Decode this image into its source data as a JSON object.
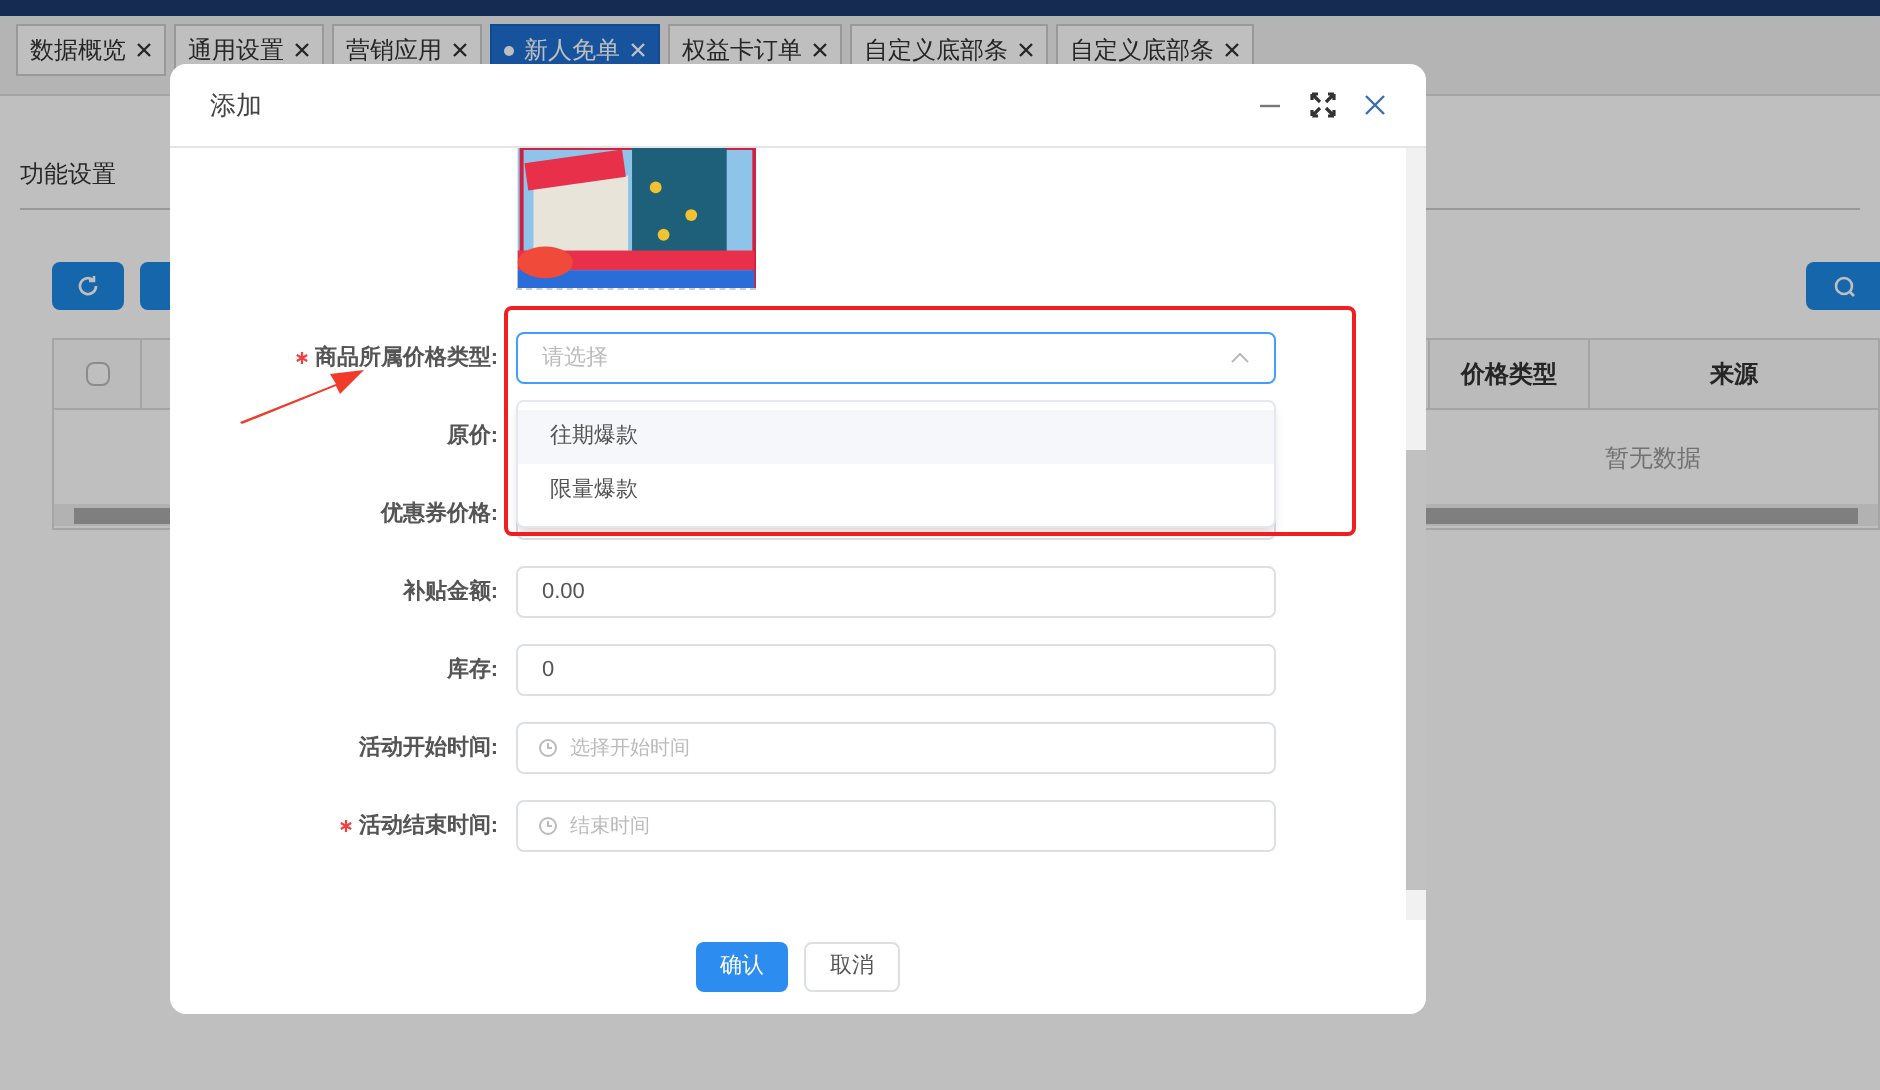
{
  "tabs": [
    {
      "label": "数据概览",
      "selected": false
    },
    {
      "label": "通用设置",
      "selected": false
    },
    {
      "label": "营销应用",
      "selected": false
    },
    {
      "label": "新人免单",
      "selected": true
    },
    {
      "label": "权益卡订单",
      "selected": false
    },
    {
      "label": "自定义底部条",
      "selected": false
    },
    {
      "label": "自定义底部条",
      "selected": false
    }
  ],
  "page": {
    "section_tab": "功能设置",
    "table": {
      "select_all_checked": false,
      "columns": [
        "价格类型",
        "来源"
      ],
      "empty_text": "暂无数据"
    }
  },
  "dialog": {
    "title": "添加",
    "form": [
      {
        "label": "商品所属价格类型:",
        "required": true,
        "kind": "select",
        "placeholder": "请选择",
        "expanded": true,
        "options": [
          {
            "label": "往期爆款",
            "hovered": true
          },
          {
            "label": "限量爆款",
            "hovered": false
          }
        ]
      },
      {
        "label": "原价:",
        "required": false,
        "kind": "input"
      },
      {
        "label": "优惠券价格:",
        "required": false,
        "kind": "input"
      },
      {
        "label": "补贴金额:",
        "required": false,
        "kind": "input",
        "value": "0.00"
      },
      {
        "label": "库存:",
        "required": false,
        "kind": "input",
        "value": "0"
      },
      {
        "label": "活动开始时间:",
        "required": false,
        "kind": "date",
        "placeholder": "选择开始时间"
      },
      {
        "label": "活动结束时间:",
        "required": true,
        "kind": "date",
        "placeholder": "结束时间"
      }
    ],
    "buttons": [
      {
        "label": "确认",
        "kind": "primary"
      },
      {
        "label": "取消",
        "kind": "default"
      }
    ]
  }
}
